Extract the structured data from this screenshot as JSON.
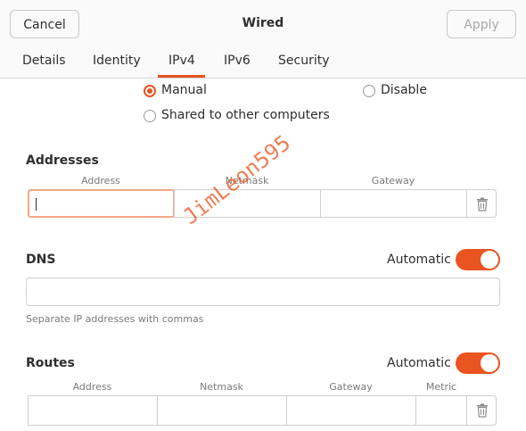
{
  "header": {
    "cancel_label": "Cancel",
    "title": "Wired",
    "apply_label": "Apply"
  },
  "tabs": [
    {
      "label": "Details",
      "active": false
    },
    {
      "label": "Identity",
      "active": false
    },
    {
      "label": "IPv4",
      "active": true
    },
    {
      "label": "IPv6",
      "active": false
    },
    {
      "label": "Security",
      "active": false
    }
  ],
  "method": {
    "options": [
      {
        "label": "Manual",
        "selected": true
      },
      {
        "label": "Disable",
        "selected": false
      },
      {
        "label": "Shared to other computers",
        "selected": false
      }
    ]
  },
  "addresses": {
    "title": "Addresses",
    "columns": [
      "Address",
      "Netmask",
      "Gateway"
    ],
    "row": {
      "address": "",
      "netmask": "",
      "gateway": ""
    }
  },
  "dns": {
    "title": "DNS",
    "automatic_label": "Automatic",
    "automatic_on": true,
    "value": "",
    "hint": "Separate IP addresses with commas"
  },
  "routes": {
    "title": "Routes",
    "automatic_label": "Automatic",
    "automatic_on": true,
    "columns": [
      "Address",
      "Netmask",
      "Gateway",
      "Metric"
    ]
  },
  "watermark": "JimLeon595",
  "colors": {
    "accent": "#e95420",
    "focus_border": "#f3a887"
  },
  "icons": {
    "delete": "trash-icon"
  }
}
